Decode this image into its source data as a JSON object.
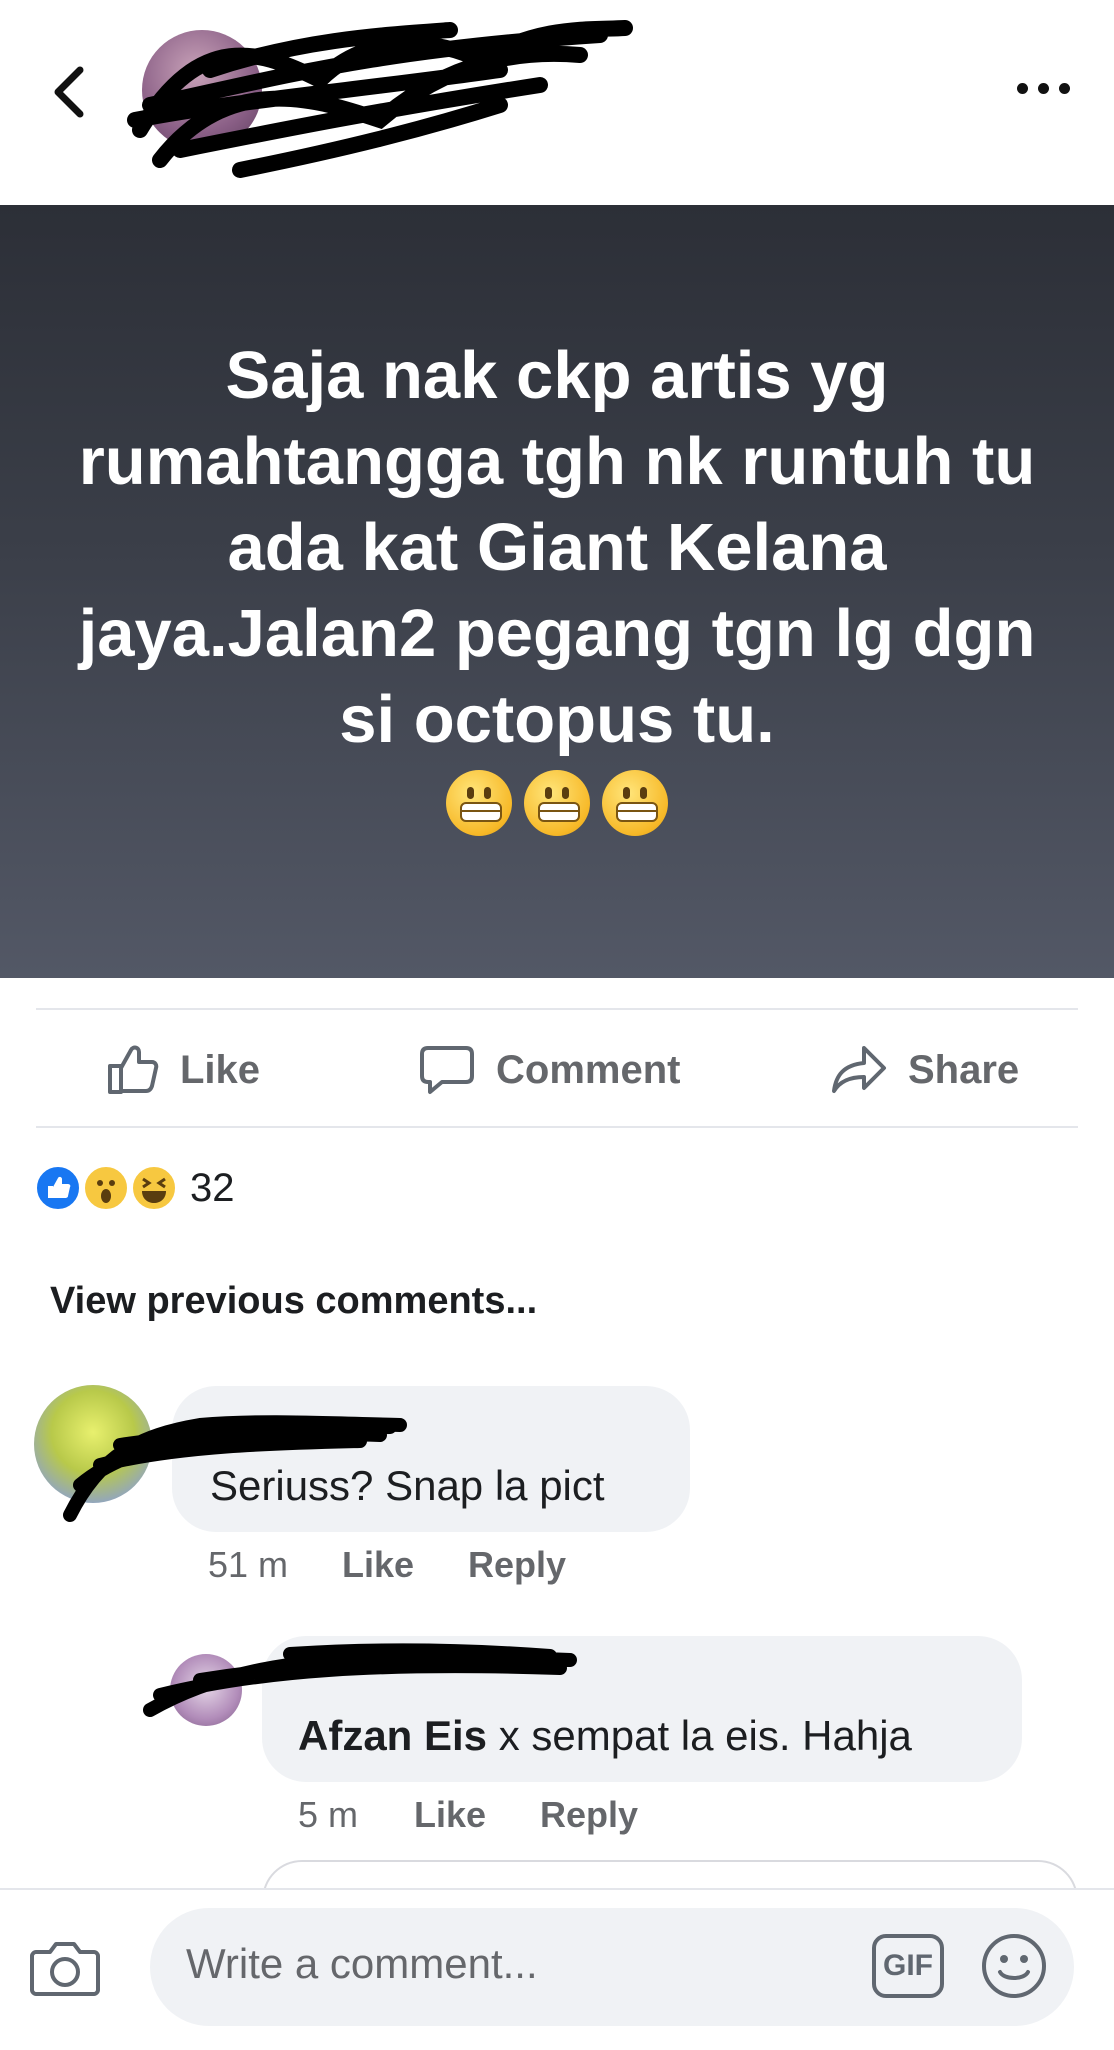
{
  "header": {
    "name_obscured": "",
    "sub_obscured": ""
  },
  "post": {
    "text": "Saja nak ckp artis yg rumahtangga tgh nk runtuh tu ada kat Giant Kelana jaya.Jalan2 pegang tgn lg dgn si octopus tu.",
    "emoji": [
      "grimacing",
      "grimacing",
      "grimacing"
    ]
  },
  "actions": {
    "like": "Like",
    "comment": "Comment",
    "share": "Share"
  },
  "reactions": {
    "types": [
      "like",
      "wow",
      "haha"
    ],
    "count": "32"
  },
  "comments": {
    "view_previous": "View previous comments...",
    "items": [
      {
        "author": "",
        "text": "Seriuss? Snap la pict",
        "time": "51 m",
        "like": "Like",
        "reply": "Reply"
      },
      {
        "author": "",
        "mention": "Afzan Eis",
        "text": " x sempat la eis. Hahja",
        "time": "5 m",
        "like": "Like",
        "reply": "Reply"
      }
    ]
  },
  "composer": {
    "placeholder": "Write a comment...",
    "gif_label": "GIF"
  },
  "colors": {
    "accent": "#1877f2",
    "post_bg_top": "#2c2f37",
    "post_bg_bottom": "#535866",
    "bubble": "#f0f2f5",
    "muted_text": "#65676b"
  }
}
